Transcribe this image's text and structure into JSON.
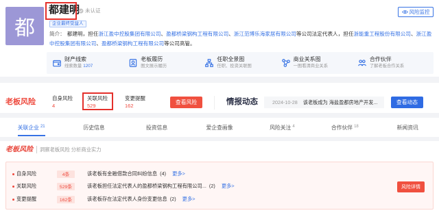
{
  "colors": {
    "accent_blue": "#3672e4",
    "risk_red": "#ee4a3e",
    "avatar_bg": "#9c97d6",
    "annotation_red": "#e4302b"
  },
  "profile": {
    "avatar_char": "都",
    "name": "都建明",
    "verify_icon": "unverified-badge-icon",
    "verify_status": "未认证",
    "tag": "企业最终受益人",
    "monitor_button": {
      "icon": "eye-icon",
      "label": "风险监控"
    },
    "intro": {
      "label": "简介：",
      "lead": "都建明，担任",
      "legal_rep_companies": [
        "浙江盈中控股集团有限公司",
        "盈都桥梁钢构工程有限公司",
        "浙江范博乐海家居有限公司"
      ],
      "separator": "、",
      "legal_rep_suffix": "等公司法定代表人，担任",
      "executive_companies": [
        "浙能重工程股份有限公司",
        "浙江盈中控股集团有限公司",
        "盈都桥梁钢构工程有限公司"
      ],
      "exec_suffix": "等公司高管。"
    }
  },
  "features": [
    {
      "icon": "wallet-icon",
      "title": "财产线索",
      "desc": "线索数量",
      "value": "1207"
    },
    {
      "icon": "resume-icon",
      "title": "老板履历",
      "desc": "图文展示履历"
    },
    {
      "icon": "org-chart-icon",
      "title": "任职全景图",
      "desc": "任职、投资关联图"
    },
    {
      "icon": "network-icon",
      "title": "商业关系图",
      "desc": "一图看清商业关系"
    },
    {
      "icon": "partner-icon",
      "title": "合作伙伴",
      "desc": "了解老板合作关系"
    }
  ],
  "risk_summary": {
    "title": "老板风险",
    "items": [
      {
        "label": "自身风险",
        "count": "4"
      },
      {
        "label": "关联风险",
        "count": "529"
      },
      {
        "label": "变更提醒",
        "count": "162"
      }
    ],
    "button": "查看风险"
  },
  "intel": {
    "title": "情报动态",
    "date": "2024-10-28",
    "text": "该老板成为 海盐盈都房地产开发...",
    "button": "查看动态"
  },
  "tabs": [
    {
      "label": "关联企业",
      "count": "21",
      "active": true
    },
    {
      "label": "历史信息"
    },
    {
      "label": "投资信息"
    },
    {
      "label": "爱企查画像"
    },
    {
      "label": "风险关注",
      "count": "4"
    },
    {
      "label": "合作伙伴",
      "count": "18"
    },
    {
      "label": "新闻资讯"
    }
  ],
  "boss_risk": {
    "title": "老板风险",
    "subtitle": "洞察老板风险 分析商业实力",
    "rows": [
      {
        "label": "自身风险",
        "count": "4条",
        "text": "该老板有金融借款合同纠纷信息",
        "num": "(4)",
        "more": "更多>"
      },
      {
        "label": "关联风险",
        "count": "529条",
        "text": "该老板担任法定代表人的盈都桥梁钢构工程有限公司...",
        "num": "(2)",
        "more": "更多>"
      },
      {
        "label": "变更提醒",
        "count": "162条",
        "text": "该老板存在法定代表人身份变更信息",
        "num": "(2)",
        "more": "更多>"
      }
    ],
    "button": "风险详情"
  }
}
